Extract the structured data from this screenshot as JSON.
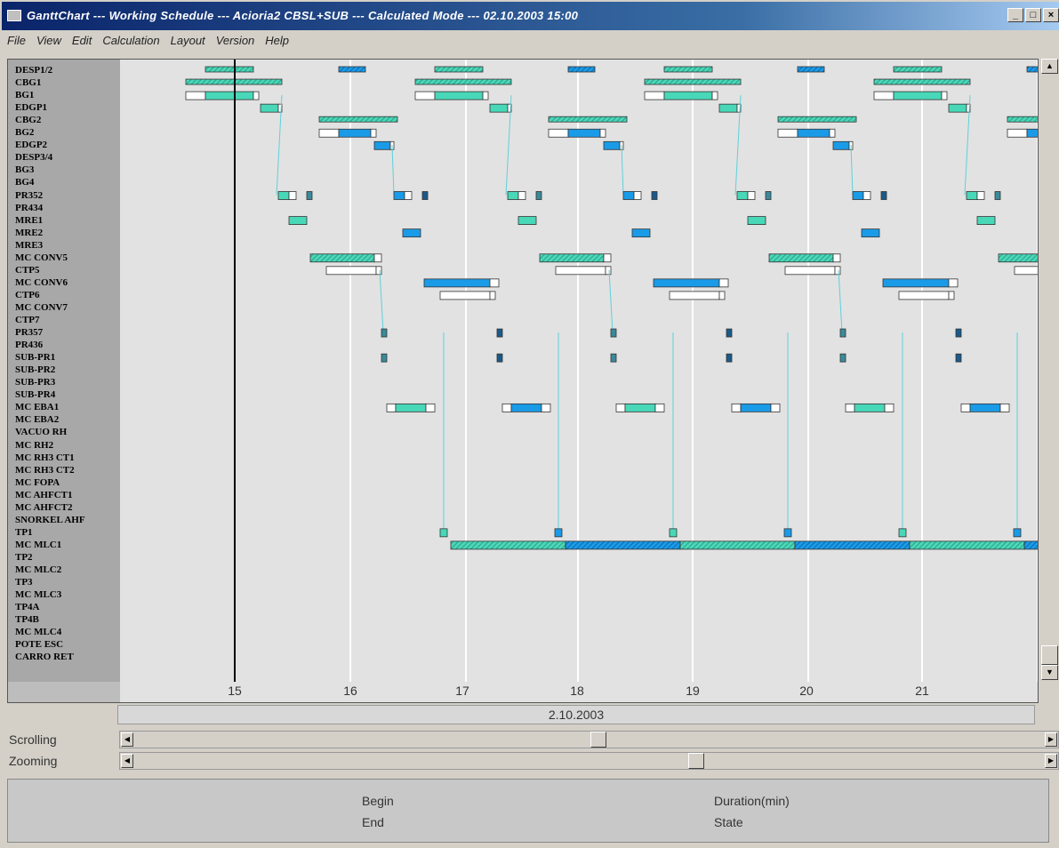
{
  "window": {
    "title": "GanttChart --- Working Schedule --- Acioria2 CBSL+SUB --- Calculated Mode --- 02.10.2003 15:00",
    "buttons": [
      "_",
      "□",
      "×"
    ]
  },
  "menu": [
    "File",
    "View",
    "Edit",
    "Calculation",
    "Layout",
    "Version",
    "Help"
  ],
  "rows": [
    "DESP1/2",
    "CBG1",
    "BG1",
    "EDGP1",
    "CBG2",
    "BG2",
    "EDGP2",
    "DESP3/4",
    "BG3",
    "BG4",
    "PR352",
    "PR434",
    "MRE1",
    "MRE2",
    "MRE3",
    "MC CONV5",
    "CTP5",
    "MC CONV6",
    "CTP6",
    "MC CONV7",
    "CTP7",
    "PR357",
    "PR436",
    "SUB-PR1",
    "SUB-PR2",
    "SUB-PR3",
    "SUB-PR4",
    "MC EBA1",
    "MC EBA2",
    "VACUO RH",
    "MC RH2",
    "MC RH3 CT1",
    "MC RH3 CT2",
    "MC FOPA",
    "MC AHFCT1",
    "MC AHFCT2",
    "SNORKEL AHF",
    "TP1",
    "MC MLC1",
    "TP2",
    "MC MLC2",
    "TP3",
    "MC MLC3",
    "TP4A",
    "TP4B",
    "MC MLC4",
    "POTE ESC",
    "CARRO RET"
  ],
  "axis": {
    "ticks": [
      "15",
      "16",
      "17",
      "18",
      "19",
      "20",
      "21"
    ],
    "date": "2.10.2003"
  },
  "colors": {
    "teal": "#48d8b8",
    "blue": "#1a9be8",
    "link": "#5fd0d8",
    "now_line": "#000000"
  },
  "controls": {
    "scrolling_label": "Scrolling",
    "zooming_label": "Zooming",
    "scroll_position": 0.51,
    "zoom_position": 0.62
  },
  "info": {
    "begin": "Begin",
    "end": "End",
    "duration": "Duration(min)",
    "state": "State"
  }
}
